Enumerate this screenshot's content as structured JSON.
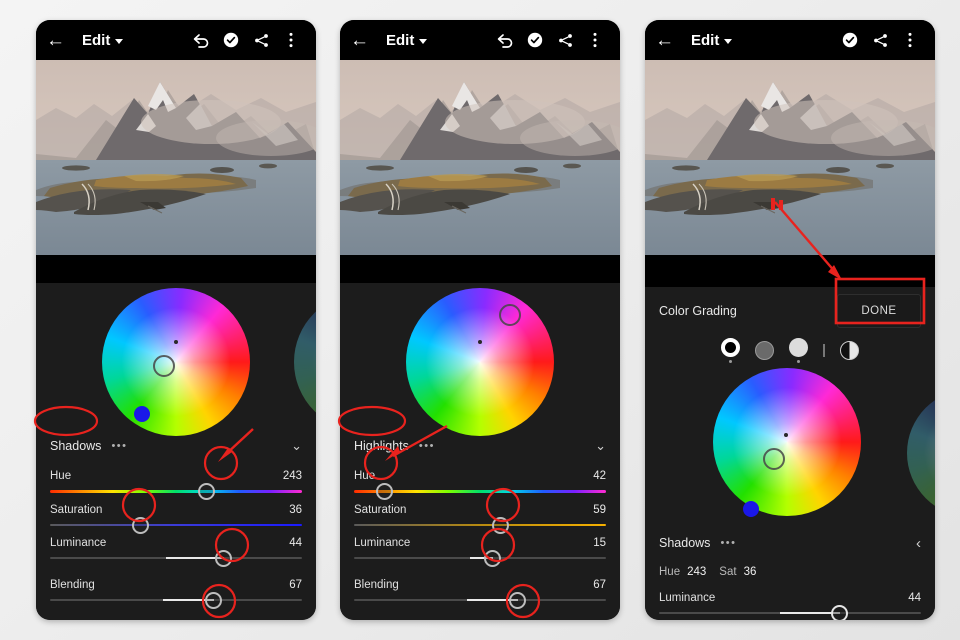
{
  "app": {
    "background_color": "#eeeeee",
    "panel_background": "#1c1c1c",
    "accent_annotation_color": "#e8231e"
  },
  "topbar": {
    "back_icon": "arrow-left-icon",
    "title": "Edit",
    "caret_icon": "chevron-down-icon",
    "undo_icon": "undo-icon",
    "check_icon": "check-circle-icon",
    "share_icon": "share-icon",
    "more_icon": "more-vertical-icon"
  },
  "photo": {
    "description": "snowy mountain peak over fjord with peninsula and road"
  },
  "panels": [
    {
      "id": "panel-shadows",
      "has_undo": true,
      "wheel": {
        "selector_label": "shadows-wheel-selector",
        "swatch_color": "#1a18e8"
      },
      "section": {
        "title": "Shadows",
        "dots": "•••",
        "chevron": "chevron-down-icon"
      },
      "sliders": [
        {
          "label": "Hue",
          "value": "243",
          "track": "hue",
          "pos": 62
        },
        {
          "label": "Saturation",
          "value": "36",
          "track": "satblue",
          "pos": 36
        },
        {
          "label": "Luminance",
          "value": "44",
          "track": "plain",
          "pos": 69,
          "fill_from": 46
        },
        {
          "label": "Blending",
          "value": "67",
          "track": "plain",
          "pos": 65,
          "fill_from": 45
        }
      ]
    },
    {
      "id": "panel-highlights",
      "has_undo": true,
      "wheel": {
        "selector_label": "highlights-wheel-selector",
        "swatch_color": "#1a18e8"
      },
      "section": {
        "title": "Highlights",
        "dots": "•••",
        "chevron": "chevron-down-icon"
      },
      "sliders": [
        {
          "label": "Hue",
          "value": "42",
          "track": "hue",
          "pos": 12
        },
        {
          "label": "Saturation",
          "value": "59",
          "track": "satgold",
          "pos": 58
        },
        {
          "label": "Luminance",
          "value": "15",
          "track": "plain",
          "pos": 55,
          "fill_from": 46
        },
        {
          "label": "Blending",
          "value": "67",
          "track": "plain",
          "pos": 65,
          "fill_from": 45
        }
      ]
    }
  ],
  "panel3": {
    "id": "panel-color-grading",
    "has_undo": false,
    "header": {
      "title": "Color Grading",
      "done_label": "DONE"
    },
    "modes": [
      {
        "name": "mode-all",
        "style": "ring",
        "selected": true,
        "has_dot": true
      },
      {
        "name": "mode-shadows",
        "style": "gray",
        "selected": false,
        "has_dot": false
      },
      {
        "name": "mode-highlights",
        "style": "light",
        "selected": false,
        "has_dot": true
      },
      {
        "name": "mode-split",
        "style": "split",
        "selected": false,
        "has_dot": false
      }
    ],
    "wheel": {
      "selector_label": "color-grading-wheel-selector",
      "swatch_color": "#1a18e8"
    },
    "section": {
      "title": "Shadows",
      "dots": "•••",
      "chevron": "chevron-left-icon"
    },
    "readout": {
      "hue_key": "Hue",
      "hue_value": "243",
      "sat_key": "Sat",
      "sat_value": "36"
    },
    "luminance": {
      "label": "Luminance",
      "value": "44",
      "pos": 69,
      "fill_from": 46
    }
  },
  "annotations": {
    "shadows_ellipse": "highlight-shadows-label",
    "highlights_ellipse": "highlight-highlights-label",
    "hue_knob_arrow": "arrow-to-hue-knob",
    "done_arrow": "arrow-to-done-button",
    "done_box": "highlight-done-button"
  }
}
